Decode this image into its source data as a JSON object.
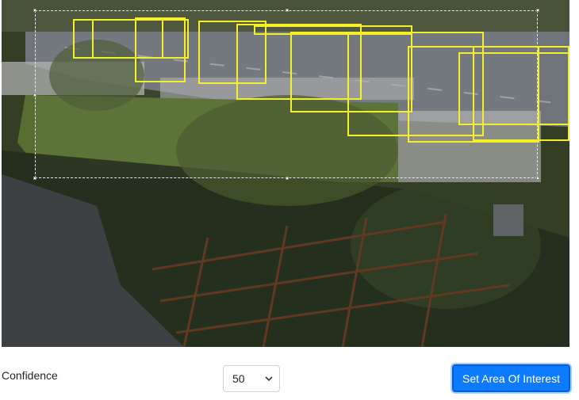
{
  "controls": {
    "confidence_label": "Confidence",
    "confidence_value": "50",
    "set_area_label": "Set Area Of Interest"
  },
  "colors": {
    "detection_box": "#f5ef2a",
    "primary_button": "#0d7bff",
    "roi_border": "#e8e8e8"
  },
  "icons": {
    "dropdown": "chevron-down-icon"
  }
}
